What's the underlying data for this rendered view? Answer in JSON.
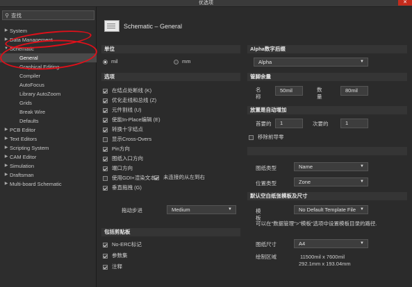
{
  "window": {
    "title": "优选项",
    "close_glyph": "✕"
  },
  "search": {
    "icon": "search-icon",
    "label": "查找"
  },
  "tree": [
    {
      "label": "System",
      "level": 0
    },
    {
      "label": "Data Management",
      "level": 0
    },
    {
      "label": "Schematic",
      "level": 0,
      "expanded": true
    },
    {
      "label": "General",
      "level": 1,
      "selected": true
    },
    {
      "label": "Graphical Editing",
      "level": 1
    },
    {
      "label": "Compiler",
      "level": 1
    },
    {
      "label": "AutoFocus",
      "level": 1
    },
    {
      "label": "Library AutoZoom",
      "level": 1
    },
    {
      "label": "Grids",
      "level": 1
    },
    {
      "label": "Break Wire",
      "level": 1
    },
    {
      "label": "Defaults",
      "level": 1
    },
    {
      "label": "PCB Editor",
      "level": 0
    },
    {
      "label": "Text Editors",
      "level": 0
    },
    {
      "label": "Scripting System",
      "level": 0
    },
    {
      "label": "CAM Editor",
      "level": 0
    },
    {
      "label": "Simulation",
      "level": 0
    },
    {
      "label": "Draftsman",
      "level": 0
    },
    {
      "label": "Multi-board Schematic",
      "level": 0
    }
  ],
  "page": {
    "title": "Schematic – General"
  },
  "units": {
    "heading": "单位",
    "mil": "mil",
    "mm": "mm",
    "selected": "mil"
  },
  "options": {
    "heading": "选项",
    "items": [
      {
        "label": "在结点处断线 (K)",
        "checked": true
      },
      {
        "label": "优化走线和总线 (Z)",
        "checked": true
      },
      {
        "label": "元件割线 (U)",
        "checked": true
      },
      {
        "label": "使能In-Place编辑 (E)",
        "checked": true
      },
      {
        "label": "转换十字结点",
        "checked": true
      },
      {
        "label": "显示Cross-Overs",
        "checked": false
      },
      {
        "label": "Pin方向",
        "checked": true
      },
      {
        "label": "图纸入口方向",
        "checked": true
      },
      {
        "label": "端口方向",
        "checked": true
      },
      {
        "label": "使用GDI+渲染文本+",
        "checked": false
      },
      {
        "label": "垂直拖拽 (G)",
        "checked": true
      }
    ],
    "port_right_label": "未连接的从左到右",
    "port_right_checked": true,
    "drag_step_label": "拖动步进",
    "drag_step_value": "Medium"
  },
  "clipboard": {
    "heading": "包括剪贴板",
    "items": [
      {
        "label": "No-ERC标记",
        "checked": true
      },
      {
        "label": "参数集",
        "checked": true
      },
      {
        "label": "注释",
        "checked": true
      }
    ]
  },
  "alpha": {
    "heading": "Alpha数字后缀",
    "value": "Alpha"
  },
  "pin_margin": {
    "heading": "管脚余量",
    "name_label": "名称",
    "name_value": "50mil",
    "number_label": "数量",
    "number_value": "80mil"
  },
  "auto_increment": {
    "heading": "放置是自动增加",
    "primary_label": "首要的",
    "primary_value": "1",
    "secondary_label": "次要的",
    "secondary_value": "1",
    "remove_leading_label": "移除前导零",
    "remove_leading_checked": false
  },
  "sheet": {
    "type_label": "图纸类型",
    "type_value": "Name",
    "position_label": "位置类型",
    "position_value": "Zone"
  },
  "template": {
    "heading": "默认空白纸张模板及尺寸",
    "template_label": "模板",
    "template_value": "No Default Template File",
    "hint": "可以在\"数据管理\">\"模板\"选项中设置模板目录的路径.",
    "size_label": "图纸尺寸",
    "size_value": "A4",
    "area_label": "绘制区域",
    "area_mil": "11500mil x 7600mil",
    "area_mm": "292.1mm x 193.04mm"
  },
  "colors": {
    "annotation": "#e0101a"
  }
}
